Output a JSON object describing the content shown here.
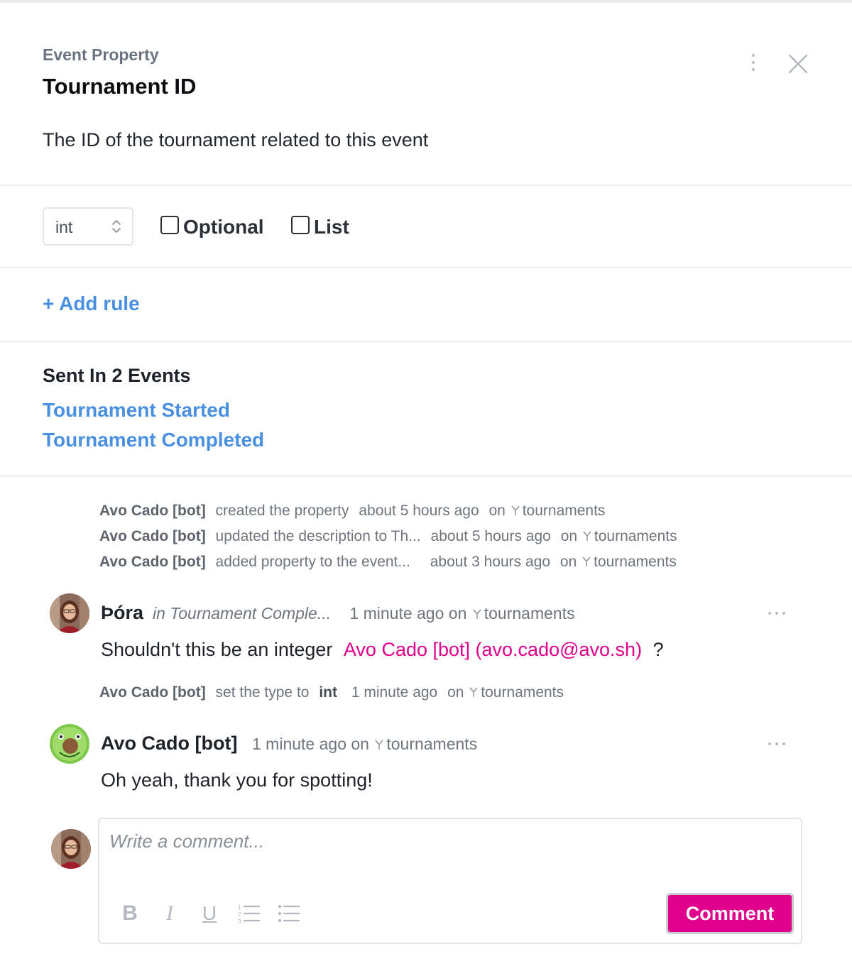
{
  "header": {
    "eyebrow": "Event Property",
    "title": "Tournament ID",
    "description": "The ID of the tournament related to this event"
  },
  "type_row": {
    "type_value": "int",
    "optional_label": "Optional",
    "optional_checked": false,
    "list_label": "List",
    "list_checked": false
  },
  "rules": {
    "add_rule_label": "+ Add rule"
  },
  "sent_in": {
    "title": "Sent In 2 Events",
    "events": [
      "Tournament Started",
      "Tournament Completed"
    ]
  },
  "activity": [
    {
      "actor": "Avo Cado [bot]",
      "action": "created the property",
      "time": "about 5 hours ago",
      "on": "on",
      "branch": "tournaments"
    },
    {
      "actor": "Avo Cado [bot]",
      "action": "updated the description to Th...",
      "time": "about 5 hours ago",
      "on": "on",
      "branch": "tournaments"
    },
    {
      "actor": "Avo Cado [bot]",
      "action": "added property to the event...",
      "time": "about 3 hours ago",
      "on": "on",
      "branch": "tournaments"
    }
  ],
  "comment1": {
    "author": "Þóra",
    "context": "in Tournament Comple...",
    "time": "1 minute ago on",
    "branch": "tournaments",
    "body_text": "Shouldn't this be an integer",
    "mention": "Avo Cado [bot] (avo.cado@avo.sh)",
    "body_end": "?"
  },
  "type_change": {
    "actor": "Avo Cado [bot]",
    "action": "set the type to",
    "type": "int",
    "time": "1 minute ago",
    "on": "on",
    "branch": "tournaments"
  },
  "comment2": {
    "author": "Avo Cado [bot]",
    "time": "1 minute ago on",
    "branch": "tournaments",
    "body": "Oh yeah, thank you for spotting!"
  },
  "composer": {
    "placeholder": "Write a comment...",
    "submit_label": "Comment",
    "toolbar": [
      "bold-icon",
      "italic-icon",
      "underline-icon",
      "ordered-list-icon",
      "bullet-list-icon"
    ]
  },
  "colors": {
    "link": "#4a90e2",
    "mention": "#e0008c",
    "button": "#e0008c"
  }
}
